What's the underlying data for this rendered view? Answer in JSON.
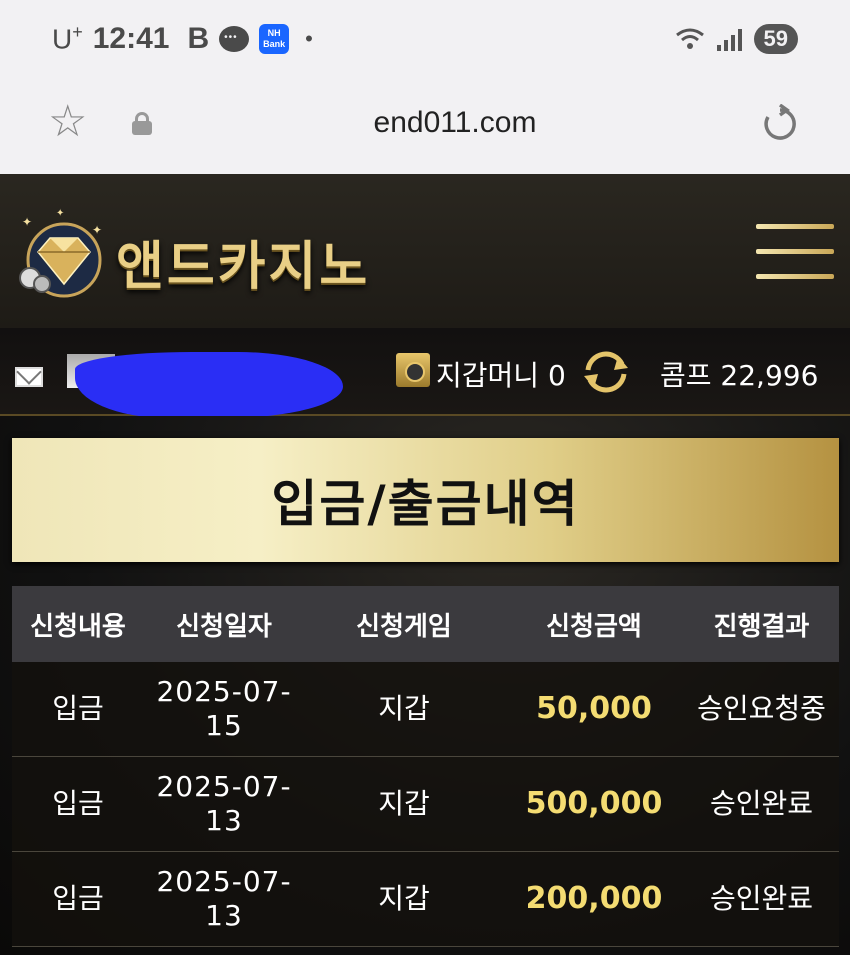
{
  "status_bar": {
    "carrier": "U",
    "carrier_sup": "+",
    "time": "12:41",
    "app_b": "B",
    "nh_label_1": "NH",
    "nh_label_2": "Bank",
    "dot": "•",
    "battery": "59"
  },
  "browser": {
    "url": "end011.com"
  },
  "site": {
    "logo_text": "앤드카지노",
    "accent_color": "#e9cf86"
  },
  "user_bar": {
    "wallet_label": "지갑머니 0",
    "comp_label": "콤프 22,996"
  },
  "page": {
    "title": "입금/출금내역"
  },
  "table": {
    "headers": [
      "신청내용",
      "신청일자",
      "신청게임",
      "신청금액",
      "진행결과"
    ],
    "rows": [
      {
        "type": "입금",
        "date_a": "2025-07-",
        "date_b": "15",
        "game": "지갑",
        "amount": "50,000",
        "status": "승인요청중"
      },
      {
        "type": "입금",
        "date_a": "2025-07-",
        "date_b": "13",
        "game": "지갑",
        "amount": "500,000",
        "status": "승인완료"
      },
      {
        "type": "입금",
        "date_a": "2025-07-",
        "date_b": "13",
        "game": "지갑",
        "amount": "200,000",
        "status": "승인완료"
      }
    ]
  }
}
